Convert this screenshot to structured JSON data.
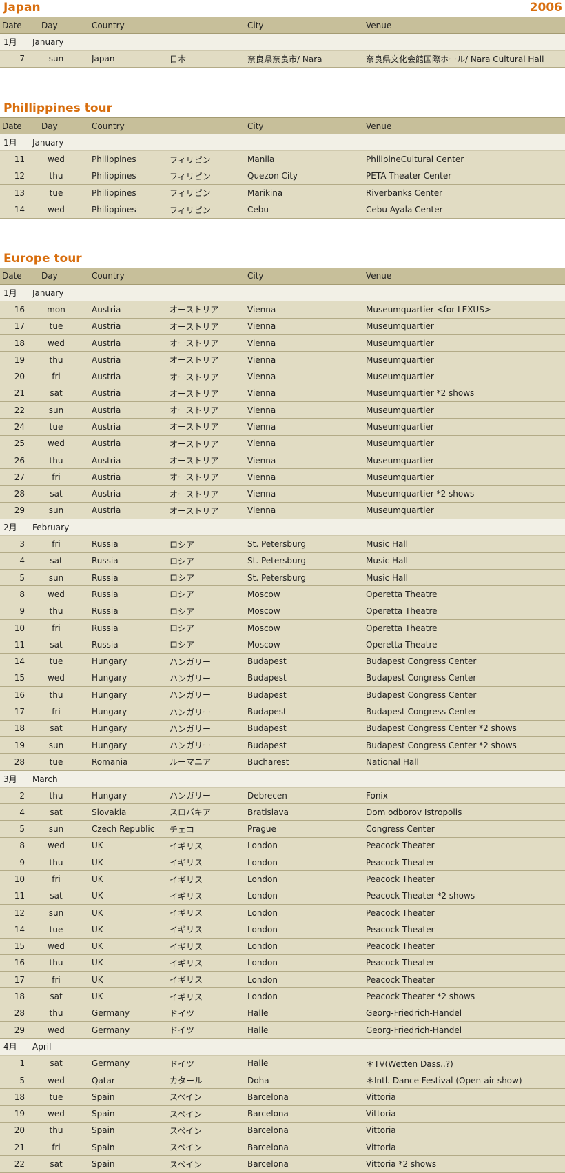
{
  "headers": {
    "date": "Date",
    "day": "Day",
    "country": "Country",
    "city": "City",
    "venue": "Venue"
  },
  "sections": [
    {
      "title": "Japan",
      "year": "2006",
      "groups": [
        {
          "month_num": "1月",
          "month_name": "January",
          "rows": [
            [
              "7",
              "sun",
              "Japan",
              "日本",
              "奈良県奈良市/ Nara",
              "奈良県文化会館国際ホール/ Nara Cultural Hall"
            ]
          ]
        }
      ]
    },
    {
      "title": "Phillippines tour",
      "year": "",
      "groups": [
        {
          "month_num": "1月",
          "month_name": "January",
          "rows": [
            [
              "11",
              "wed",
              "Philippines",
              "フィリピン",
              "Manila",
              "PhilipineCultural Center"
            ],
            [
              "12",
              "thu",
              "Philippines",
              "フィリピン",
              "Quezon City",
              "PETA Theater Center"
            ],
            [
              "13",
              "tue",
              "Philippines",
              "フィリピン",
              "Marikina",
              "Riverbanks Center"
            ],
            [
              "14",
              "wed",
              "Philippines",
              "フィリピン",
              "Cebu",
              "Cebu Ayala Center"
            ]
          ]
        }
      ]
    },
    {
      "title": "Europe tour",
      "year": "",
      "groups": [
        {
          "month_num": "1月",
          "month_name": "January",
          "rows": [
            [
              "16",
              "mon",
              "Austria",
              "オーストリア",
              "Vienna",
              "Museumquartier <for LEXUS>"
            ],
            [
              "17",
              "tue",
              "Austria",
              "オーストリア",
              "Vienna",
              "Museumquartier"
            ],
            [
              "18",
              "wed",
              "Austria",
              "オーストリア",
              "Vienna",
              "Museumquartier"
            ],
            [
              "19",
              "thu",
              "Austria",
              "オーストリア",
              "Vienna",
              "Museumquartier"
            ],
            [
              "20",
              "fri",
              "Austria",
              "オーストリア",
              "Vienna",
              "Museumquartier"
            ],
            [
              "21",
              "sat",
              "Austria",
              "オーストリア",
              "Vienna",
              "Museumquartier  *2 shows"
            ],
            [
              "22",
              "sun",
              "Austria",
              "オーストリア",
              "Vienna",
              "Museumquartier"
            ],
            [
              "24",
              "tue",
              "Austria",
              "オーストリア",
              "Vienna",
              "Museumquartier"
            ],
            [
              "25",
              "wed",
              "Austria",
              "オーストリア",
              "Vienna",
              "Museumquartier"
            ],
            [
              "26",
              "thu",
              "Austria",
              "オーストリア",
              "Vienna",
              "Museumquartier"
            ],
            [
              "27",
              "fri",
              "Austria",
              "オーストリア",
              "Vienna",
              "Museumquartier"
            ],
            [
              "28",
              "sat",
              "Austria",
              "オーストリア",
              "Vienna",
              "Museumquartier  *2 shows"
            ],
            [
              "29",
              "sun",
              "Austria",
              "オーストリア",
              "Vienna",
              "Museumquartier"
            ]
          ]
        },
        {
          "month_num": "2月",
          "month_name": "February",
          "rows": [
            [
              "3",
              "fri",
              "Russia",
              "ロシア",
              "St. Petersburg",
              "Music Hall"
            ],
            [
              "4",
              "sat",
              "Russia",
              "ロシア",
              "St. Petersburg",
              "Music Hall"
            ],
            [
              "5",
              "sun",
              "Russia",
              "ロシア",
              "St. Petersburg",
              "Music Hall"
            ],
            [
              "8",
              "wed",
              "Russia",
              "ロシア",
              "Moscow",
              "Operetta Theatre"
            ],
            [
              "9",
              "thu",
              "Russia",
              "ロシア",
              "Moscow",
              "Operetta Theatre"
            ],
            [
              "10",
              "fri",
              "Russia",
              "ロシア",
              "Moscow",
              "Operetta Theatre"
            ],
            [
              "11",
              "sat",
              "Russia",
              "ロシア",
              "Moscow",
              "Operetta Theatre"
            ],
            [
              "14",
              "tue",
              "Hungary",
              "ハンガリー",
              "Budapest",
              "Budapest Congress Center"
            ],
            [
              "15",
              "wed",
              "Hungary",
              "ハンガリー",
              "Budapest",
              "Budapest Congress Center"
            ],
            [
              "16",
              "thu",
              "Hungary",
              "ハンガリー",
              "Budapest",
              "Budapest Congress Center"
            ],
            [
              "17",
              "fri",
              "Hungary",
              "ハンガリー",
              "Budapest",
              "Budapest Congress Center"
            ],
            [
              "18",
              "sat",
              "Hungary",
              "ハンガリー",
              "Budapest",
              "Budapest Congress Center  *2 shows"
            ],
            [
              "19",
              "sun",
              "Hungary",
              "ハンガリー",
              "Budapest",
              "Budapest Congress Center  *2 shows"
            ],
            [
              "28",
              "tue",
              "Romania",
              "ルーマニア",
              "Bucharest",
              "National Hall"
            ]
          ]
        },
        {
          "month_num": "3月",
          "month_name": "March",
          "rows": [
            [
              "2",
              "thu",
              "Hungary",
              "ハンガリー",
              "Debrecen",
              "Fonix"
            ],
            [
              "4",
              "sat",
              "Slovakia",
              "スロバキア",
              "Bratislava",
              "Dom odborov Istropolis"
            ],
            [
              "5",
              "sun",
              "Czech Republic",
              "チェコ",
              "Prague",
              "Congress Center"
            ],
            [
              "8",
              "wed",
              "UK",
              "イギリス",
              "London",
              "Peacock Theater"
            ],
            [
              "9",
              "thu",
              "UK",
              "イギリス",
              "London",
              "Peacock Theater"
            ],
            [
              "10",
              "fri",
              "UK",
              "イギリス",
              "London",
              "Peacock Theater"
            ],
            [
              "11",
              "sat",
              "UK",
              "イギリス",
              "London",
              "Peacock Theater  *2 shows"
            ],
            [
              "12",
              "sun",
              "UK",
              "イギリス",
              "London",
              "Peacock Theater"
            ],
            [
              "14",
              "tue",
              "UK",
              "イギリス",
              "London",
              "Peacock Theater"
            ],
            [
              "15",
              "wed",
              "UK",
              "イギリス",
              "London",
              "Peacock Theater"
            ],
            [
              "16",
              "thu",
              "UK",
              "イギリス",
              "London",
              "Peacock Theater"
            ],
            [
              "17",
              "fri",
              "UK",
              "イギリス",
              "London",
              "Peacock Theater"
            ],
            [
              "18",
              "sat",
              "UK",
              "イギリス",
              "London",
              "Peacock Theater  *2 shows"
            ],
            [
              "28",
              "thu",
              "Germany",
              "ドイツ",
              "Halle",
              "Georg-Friedrich-Handel"
            ],
            [
              "29",
              "wed",
              "Germany",
              "ドイツ",
              "Halle",
              "Georg-Friedrich-Handel"
            ]
          ]
        },
        {
          "month_num": "4月",
          "month_name": "April",
          "rows": [
            [
              "1",
              "sat",
              "Germany",
              "ドイツ",
              "Halle",
              "＊TV(Wetten Dass..?)"
            ],
            [
              "5",
              "wed",
              "Qatar",
              "カタール",
              "Doha",
              "＊Intl. Dance Festival (Open-air show)"
            ],
            [
              "18",
              "tue",
              "Spain",
              "スペイン",
              "Barcelona",
              "Vittoria"
            ],
            [
              "19",
              "wed",
              "Spain",
              "スペイン",
              "Barcelona",
              "Vittoria"
            ],
            [
              "20",
              "thu",
              "Spain",
              "スペイン",
              "Barcelona",
              "Vittoria"
            ],
            [
              "21",
              "fri",
              "Spain",
              "スペイン",
              "Barcelona",
              "Vittoria"
            ],
            [
              "22",
              "sat",
              "Spain",
              "スペイン",
              "Barcelona",
              "Vittoria  *2 shows"
            ]
          ]
        }
      ]
    }
  ]
}
